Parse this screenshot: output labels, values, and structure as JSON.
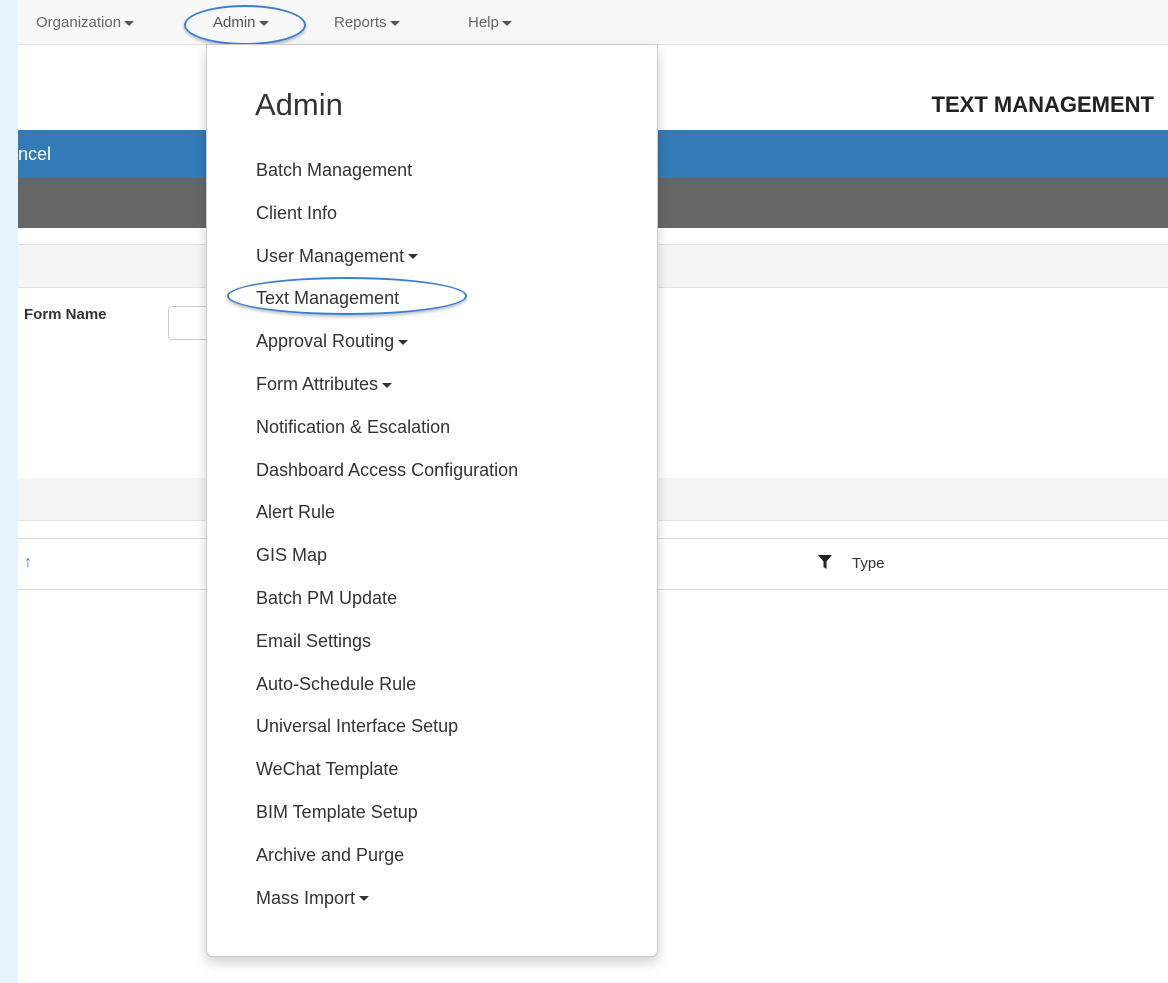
{
  "navbar": {
    "items": [
      {
        "label": "Organization"
      },
      {
        "label": "Admin"
      },
      {
        "label": "Reports"
      },
      {
        "label": "Help"
      }
    ]
  },
  "page": {
    "title": "TEXT MANAGEMENT",
    "blue_bar_text": "ncel",
    "form_label": "Form Name",
    "table_column_type": "Type"
  },
  "dropdown": {
    "header": "Admin",
    "items": [
      {
        "label": "Batch Management",
        "submenu": false
      },
      {
        "label": "Client Info",
        "submenu": false
      },
      {
        "label": "User Management",
        "submenu": true
      },
      {
        "label": "Text Management",
        "submenu": false
      },
      {
        "label": "Approval Routing",
        "submenu": true
      },
      {
        "label": "Form Attributes",
        "submenu": true
      },
      {
        "label": "Notification & Escalation",
        "submenu": false
      },
      {
        "label": "Dashboard Access Configuration",
        "submenu": false
      },
      {
        "label": "Alert Rule",
        "submenu": false
      },
      {
        "label": "GIS Map",
        "submenu": false
      },
      {
        "label": "Batch PM Update",
        "submenu": false
      },
      {
        "label": "Email Settings",
        "submenu": false
      },
      {
        "label": "Auto-Schedule Rule",
        "submenu": false
      },
      {
        "label": "Universal Interface Setup",
        "submenu": false
      },
      {
        "label": "WeChat Template",
        "submenu": false
      },
      {
        "label": "BIM Template Setup",
        "submenu": false
      },
      {
        "label": "Archive and Purge",
        "submenu": false
      },
      {
        "label": "Mass Import",
        "submenu": true
      }
    ]
  },
  "colors": {
    "primary_blue": "#337ab7",
    "header_gray": "#666666",
    "highlight_ring": "#3b7fd3"
  }
}
